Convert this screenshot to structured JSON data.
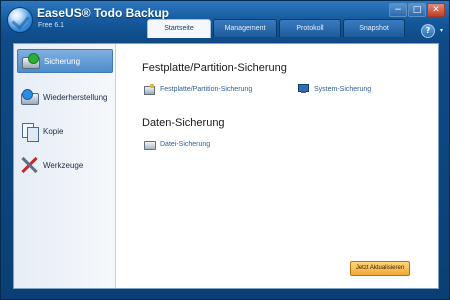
{
  "app": {
    "title": "EaseUS® Todo Backup",
    "edition": "Free 6.1"
  },
  "window_controls": [
    "−",
    "□",
    "✕"
  ],
  "tabs": [
    {
      "label": "Startseite",
      "active": true
    },
    {
      "label": "Management",
      "active": false
    },
    {
      "label": "Protokoll",
      "active": false
    },
    {
      "label": "Snapshot",
      "active": false
    }
  ],
  "help": {
    "label": "?",
    "caret": "▾"
  },
  "sidebar": {
    "items": [
      {
        "label": "Sicherung",
        "icon": "backup-icon",
        "selected": true
      },
      {
        "label": "Wiederherstellung",
        "icon": "restore-icon",
        "selected": false
      },
      {
        "label": "Kopie",
        "icon": "copy-icon",
        "selected": false
      },
      {
        "label": "Werkzeuge",
        "icon": "tools-icon",
        "selected": false
      }
    ]
  },
  "main": {
    "sections": [
      {
        "title": "Festplatte/Partition-Sicherung",
        "links": [
          {
            "label": "Festplatte/Partition-Sicherung",
            "icon": "disk-icon"
          },
          {
            "label": "System-Sicherung",
            "icon": "system-icon"
          }
        ]
      },
      {
        "title": "Daten-Sicherung",
        "links": [
          {
            "label": "Datei-Sicherung",
            "icon": "file-icon"
          }
        ]
      }
    ],
    "update_button": "Jetzt Aktualisieren"
  },
  "colors": {
    "accent": "#4e8ccb",
    "link": "#2f5f96",
    "update_button": "#f0a935"
  }
}
